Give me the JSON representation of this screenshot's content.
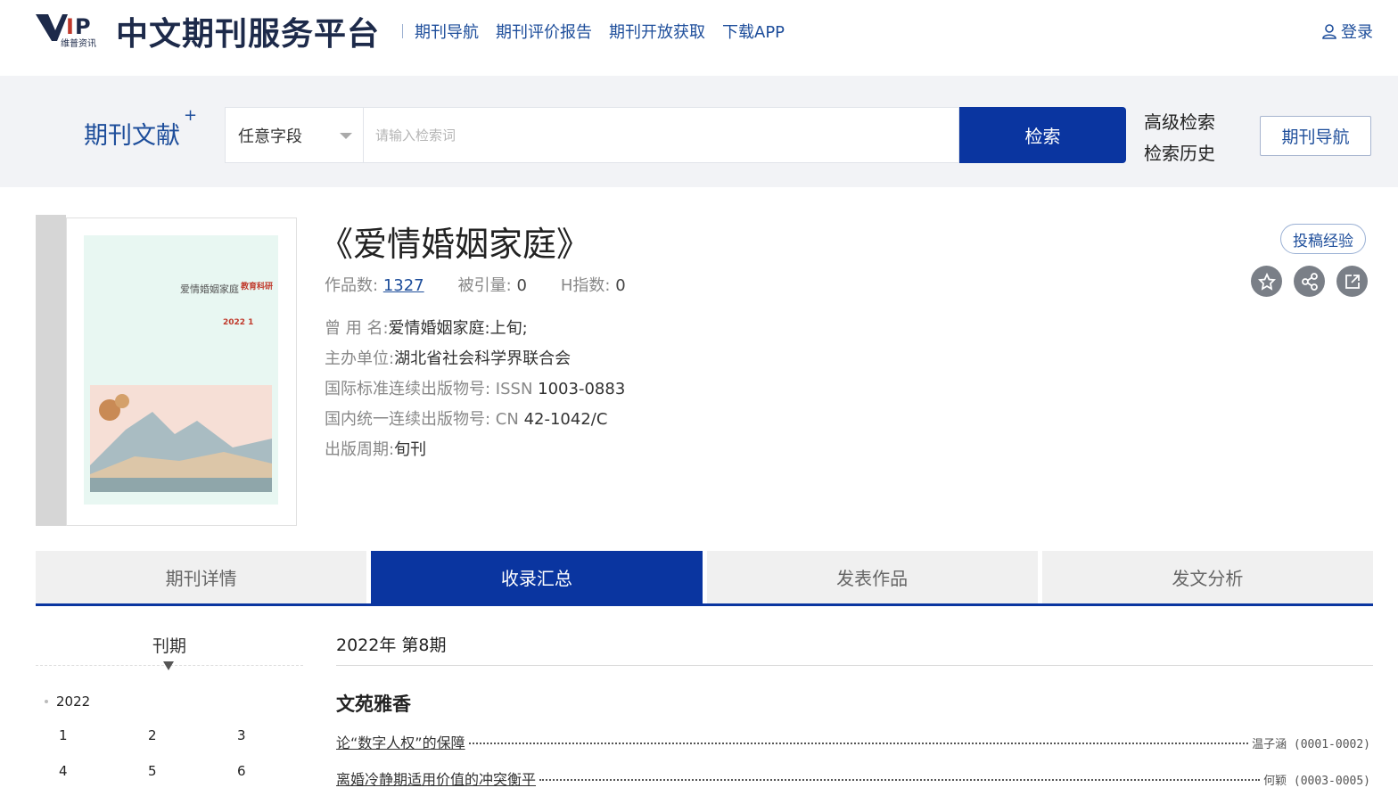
{
  "header": {
    "logo_text": "VIP",
    "logo_sub": "维普资讯",
    "platform_title": "中文期刊服务平台",
    "nav": [
      "期刊导航",
      "期刊评价报告",
      "期刊开放获取",
      "下载APP"
    ],
    "login": "登录"
  },
  "search": {
    "scope": "期刊文献",
    "scope_plus": "+",
    "field": "任意字段",
    "placeholder": "请输入检索词",
    "button": "检索",
    "advanced": "高级检索",
    "history": "检索历史",
    "nav_button": "期刊导航"
  },
  "journal": {
    "title": "《爱情婚姻家庭》",
    "cover_title": "爱情婚姻家庭",
    "cover_badge": "教育科研",
    "cover_year": "2022 1",
    "works_label": "作品数:",
    "works": "1327",
    "cited_label": "被引量:",
    "cited": "0",
    "h_label": "H指数:",
    "h": "0",
    "meta": [
      {
        "label": "曾  用  名:",
        "value": "爱情婚姻家庭:上旬;"
      },
      {
        "label": "主办单位:",
        "value": "湖北省社会科学界联合会"
      },
      {
        "label": "国际标准连续出版物号: ISSN",
        "value": "1003-0883"
      },
      {
        "label": "国内统一连续出版物号: CN",
        "value": "42-1042/C"
      },
      {
        "label": "出版周期:",
        "value": "旬刊"
      }
    ],
    "submit_exp": "投稿经验",
    "icons": [
      "star-icon",
      "share-icon",
      "external-link-icon"
    ]
  },
  "tabs": [
    {
      "label": "期刊详情",
      "active": false
    },
    {
      "label": "收录汇总",
      "active": true
    },
    {
      "label": "发表作品",
      "active": false
    },
    {
      "label": "发文分析",
      "active": false
    }
  ],
  "issues": {
    "label": "刊期",
    "year": "2022",
    "numbers": [
      "1",
      "2",
      "3",
      "4",
      "5",
      "6"
    ]
  },
  "contents": {
    "issue": "2022年 第8期",
    "section": "文苑雅香",
    "articles": [
      {
        "title": "论“数字人权”的保障",
        "author": "温子涵 (0001-0002)"
      },
      {
        "title": "离婚冷静期适用价值的冲突衡平",
        "author": "何颖 (0003-0005)"
      }
    ]
  },
  "colors": {
    "brand": "#0a35a0",
    "link": "#1e4e9b",
    "band": "#f2f3f6"
  }
}
